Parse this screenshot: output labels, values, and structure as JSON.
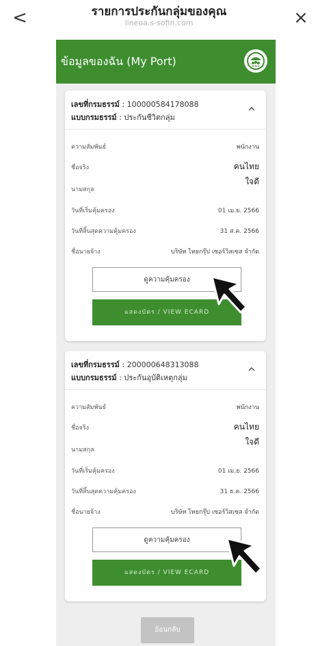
{
  "topbar": {
    "back_icon": "chevron-left-icon",
    "back_glyph": "<",
    "close_icon": "close-icon",
    "close_glyph": "×",
    "title": "รายการประกันกลุ่มของคุณ",
    "subtitle": "lineoa.s-sofin.com"
  },
  "header": {
    "title": "ข้อมูลของฉัน (My Port)",
    "icon": "group-umbrella-icon"
  },
  "colors": {
    "brand_green": "#3e8e2f",
    "panel_bg": "#eeeeee",
    "disabled_button": "#c3c3c3"
  },
  "labels": {
    "relationship": "ความสัมพันธ์",
    "first_name": "ชื่อจริง",
    "last_name": "นามสกุล",
    "coverage_start": "วันที่เริ่มคุ้มครอง",
    "coverage_end": "วันที่สิ้นสุดความคุ้มครอง",
    "employer": "ชื่อนายจ้าง",
    "policy_no_label": "เลขที่กรมธรรม์",
    "policy_type_label": "แบบกรมธรรม์"
  },
  "policies": [
    {
      "policy_no": "100000584178088",
      "policy_type": "ประกันชีวิตกลุ่ม",
      "relationship": "พนักงาน",
      "first_name": "คนไทย",
      "last_name": "ใจดี",
      "coverage_start": "01 เม.ย. 2566",
      "coverage_end": "31 ส.ค. 2566",
      "employer": "บริษัท ไทยกรุ๊ป เซอร์วิสเซส จำกัด",
      "view_coverage": "ดูความคุ้มครอง",
      "view_ecard": "แสดงบัตร / VIEW ECARD"
    },
    {
      "policy_no": "200000648313088",
      "policy_type": "ประกันอุบัติเหตุกลุ่ม",
      "relationship": "พนักงาน",
      "first_name": "คนไทย",
      "last_name": "ใจดี",
      "coverage_start": "01 เม.ย. 2566",
      "coverage_end": "31 ธ.ค. 2566",
      "employer": "บริษัท ไทยกรุ๊ป เซอร์วิสเซส จำกัด",
      "view_coverage": "ดูความคุ้มครอง",
      "view_ecard": "แสดงบัตร / VIEW ECARD"
    }
  ],
  "footer": {
    "back_label": "ย้อนกลับ"
  }
}
